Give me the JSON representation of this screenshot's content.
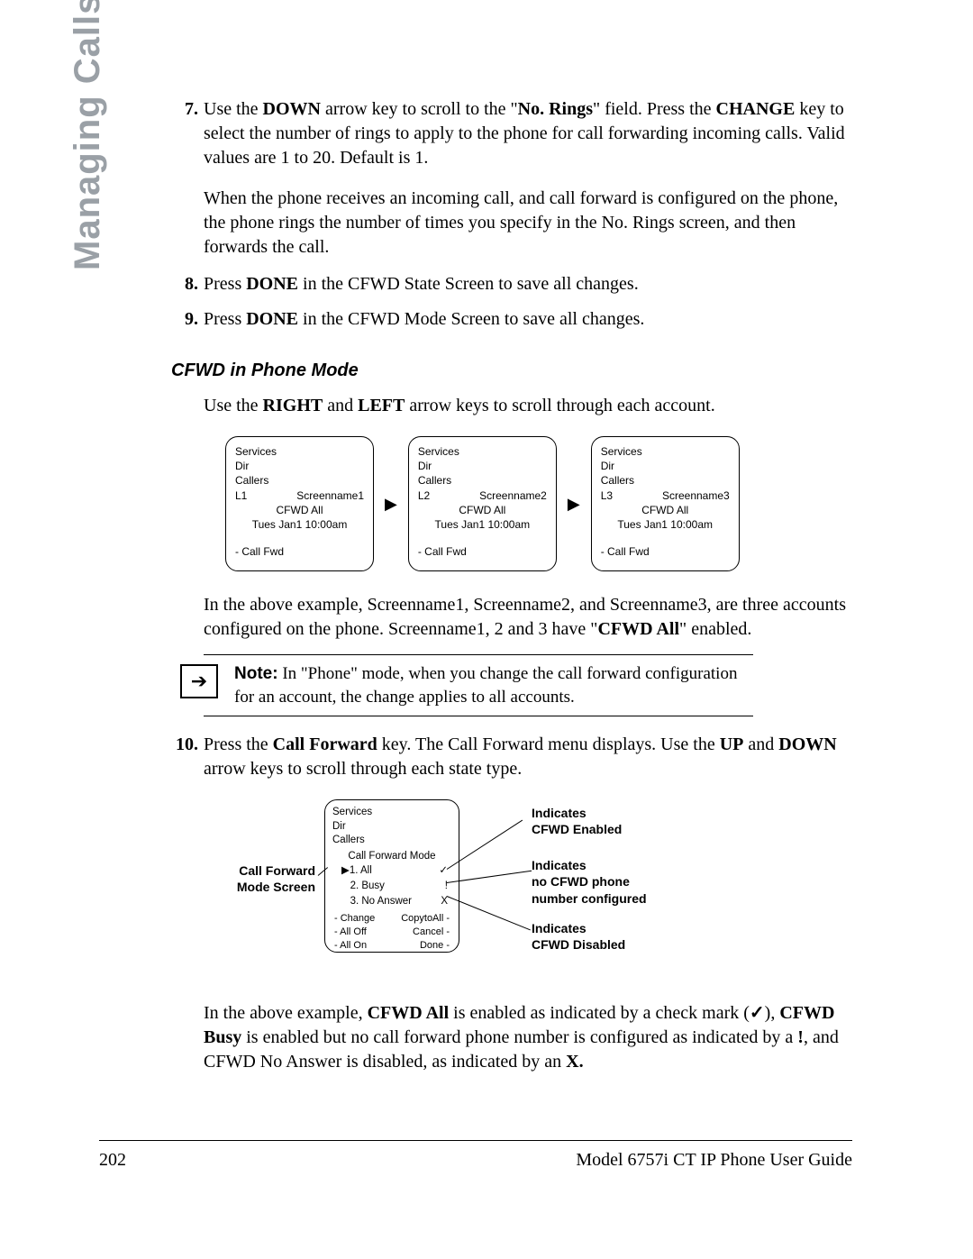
{
  "sidebar": {
    "heading": "Managing Calls"
  },
  "steps": {
    "s7_num": "7.",
    "s7_a": "Use the ",
    "s7_b": "DOWN",
    "s7_c": " arrow key to scroll to the \"",
    "s7_d": "No. Rings",
    "s7_e": "\" field. Press the ",
    "s7_f": "CHANGE",
    "s7_g": " key to select the number of rings to apply to the phone for call forwarding incoming calls. Valid values are 1 to 20. Default is 1.",
    "s7_note": "When the phone receives an incoming call, and call forward is configured on the phone, the phone rings the number of times you specify in the No. Rings screen, and then forwards the call.",
    "s8_num": "8.",
    "s8_a": "Press ",
    "s8_b": "DONE",
    "s8_c": " in the CFWD State Screen to save all changes.",
    "s9_num": "9.",
    "s9_a": "Press ",
    "s9_b": "DONE",
    "s9_c": " in the CFWD Mode Screen to save all changes.",
    "s10_num": "10.",
    "s10_a": "Press the ",
    "s10_b": "Call Forward",
    "s10_c": " key. The Call Forward menu displays. Use the ",
    "s10_d": "UP",
    "s10_e": " and ",
    "s10_f": "DOWN",
    "s10_g": " arrow keys to scroll through each state type."
  },
  "subhead": "CFWD in Phone Mode",
  "use_line_a": "Use the ",
  "use_line_b": "RIGHT",
  "use_line_c": " and ",
  "use_line_d": "LEFT",
  "use_line_e": " arrow keys to scroll through each account.",
  "screens": [
    {
      "services": "Services",
      "dir": "Dir",
      "callers": "Callers",
      "line": "L1",
      "name": "Screenname1",
      "cfwd": "CFWD All",
      "date": "Tues Jan1 10:00am",
      "cf": "- Call Fwd"
    },
    {
      "services": "Services",
      "dir": "Dir",
      "callers": "Callers",
      "line": "L2",
      "name": "Screenname2",
      "cfwd": "CFWD All",
      "date": "Tues Jan1 10:00am",
      "cf": "- Call Fwd"
    },
    {
      "services": "Services",
      "dir": "Dir",
      "callers": "Callers",
      "line": "L3",
      "name": "Screenname3",
      "cfwd": "CFWD All",
      "date": "Tues Jan1 10:00am",
      "cf": "- Call Fwd"
    }
  ],
  "arrow": "▶",
  "fig1_desc_a": "In the above example, Screenname1, Screenname2, and Screenname3, are three accounts configured on the phone. Screenname1, 2 and 3 have \"",
  "fig1_desc_b": "CFWD All",
  "fig1_desc_c": "\" enabled.",
  "note_label": "Note:",
  "note_body": " In \"Phone\" mode, when you change the call forward configuration for an account, the change applies to all accounts.",
  "note_arrow": "➔",
  "fig2": {
    "left_label_1": "Call Forward",
    "left_label_2": "Mode Screen",
    "services": "Services",
    "dir": "Dir",
    "callers": "Callers",
    "title": "Call Forward Mode",
    "row1_l": "▶1. All",
    "row1_r": "✓",
    "row2_l": "   2. Busy",
    "row2_r": "!",
    "row3_l": "   3. No Answer",
    "row3_r": "X",
    "b1_l": "- Change",
    "b1_r": "CopytoAll -",
    "b2_l": "- All Off",
    "b2_r": "Cancel -",
    "b3_l": "- All On",
    "b3_r": "Done -",
    "c1_a": "Indicates",
    "c1_b": "CFWD Enabled",
    "c2_a": "Indicates",
    "c2_b": "no CFWD phone",
    "c2_c": "number configured",
    "c3_a": "Indicates",
    "c3_b": "CFWD Disabled"
  },
  "fig2_desc_a": "In the above example, ",
  "fig2_desc_b": "CFWD All",
  "fig2_desc_c": " is enabled as indicated by a check mark (",
  "fig2_desc_check": "✓",
  "fig2_desc_d": "), ",
  "fig2_desc_e": "CFWD Busy",
  "fig2_desc_f": " is enabled but no call forward phone number is configured as indicated by a ",
  "fig2_desc_excl": "!",
  "fig2_desc_g": ", and CFWD No Answer is disabled, as indicated by an ",
  "fig2_desc_h": "X.",
  "footer": {
    "page": "202",
    "guide": "Model 6757i CT IP Phone User Guide"
  }
}
